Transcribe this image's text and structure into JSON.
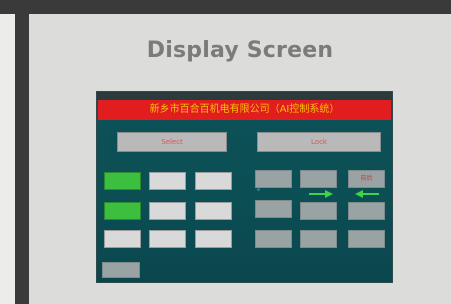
{
  "panel": {
    "title": "Display Screen"
  },
  "hmi": {
    "banner": "新乡市百合百机电有限公司（AI控制系统）",
    "left_header": "Select",
    "right_header": "Lock",
    "left_buttons": [
      [
        "",
        "",
        ""
      ],
      [
        "",
        "",
        ""
      ],
      [
        "",
        "",
        ""
      ]
    ],
    "right_buttons": [
      [
        "",
        "",
        "前后"
      ],
      [
        "",
        "",
        ""
      ],
      [
        "",
        "",
        ""
      ]
    ]
  }
}
